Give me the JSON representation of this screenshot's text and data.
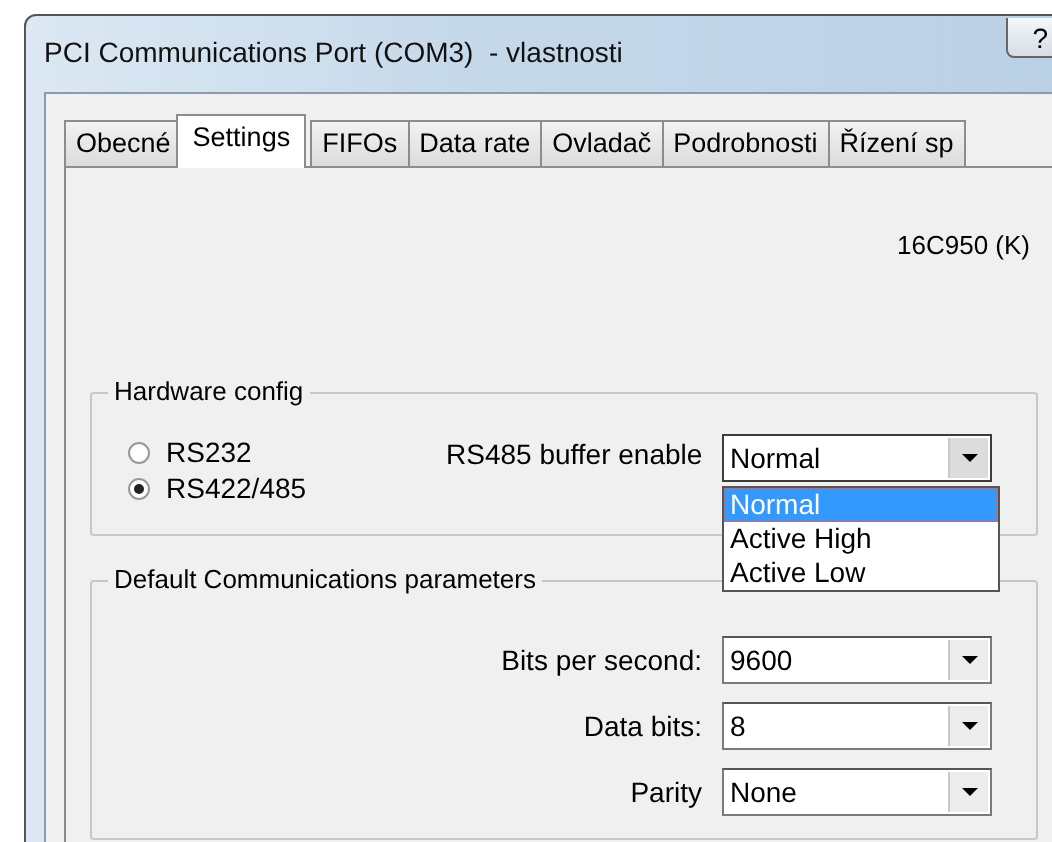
{
  "window": {
    "title": "PCI Communications Port (COM3)  - vlastnosti",
    "help_button": "?"
  },
  "tabs": [
    {
      "label": "Obecné",
      "selected": false
    },
    {
      "label": "Settings",
      "selected": true
    },
    {
      "label": "FIFOs",
      "selected": false
    },
    {
      "label": "Data rate",
      "selected": false
    },
    {
      "label": "Ovladač",
      "selected": false
    },
    {
      "label": "Podrobnosti",
      "selected": false
    },
    {
      "label": "Řízení sp",
      "selected": false
    }
  ],
  "chip_type": "16C950 (K)",
  "hardware_config": {
    "title": "Hardware config",
    "modes": [
      {
        "label": "RS232",
        "selected": false
      },
      {
        "label": "RS422/485",
        "selected": true
      }
    ],
    "buffer_enable": {
      "label": "RS485 buffer enable",
      "value": "Normal",
      "expanded": true,
      "options": [
        {
          "label": "Normal",
          "selected": true
        },
        {
          "label": "Active High",
          "selected": false
        },
        {
          "label": "Active Low",
          "selected": false
        }
      ]
    }
  },
  "default_params": {
    "title": "Default Communications parameters",
    "fields": [
      {
        "label": "Bits per second:",
        "value": "9600"
      },
      {
        "label": "Data bits:",
        "value": "8"
      },
      {
        "label": "Parity",
        "value": "None"
      }
    ]
  }
}
